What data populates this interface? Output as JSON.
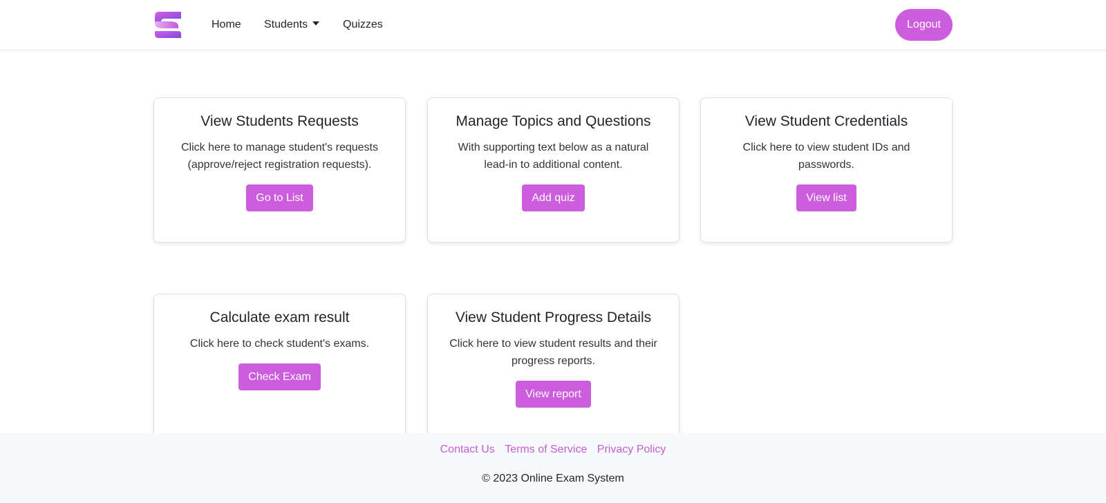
{
  "navbar": {
    "logo_icon": "brand-s-logo",
    "links": {
      "home": "Home",
      "students": "Students",
      "quizzes": "Quizzes"
    },
    "logout_label": "Logout"
  },
  "cards": [
    {
      "title": "View Students Requests",
      "text": "Click here to manage student's requests (approve/reject registration requests).",
      "button": "Go to List"
    },
    {
      "title": "Manage Topics and Questions",
      "text": "With supporting text below as a natural lead-in to additional content.",
      "button": "Add quiz"
    },
    {
      "title": "View Student Credentials",
      "text": "Click here to view student IDs and passwords.",
      "button": "View list"
    },
    {
      "title": "Calculate exam result",
      "text": "Click here to check student's exams.",
      "button": "Check Exam"
    },
    {
      "title": "View Student Progress Details",
      "text": "Click here to view student results and their progress reports.",
      "button": "View report"
    }
  ],
  "footer": {
    "links": [
      "Contact Us",
      "Terms of Service",
      "Privacy Policy"
    ],
    "copyright": "© 2023 Online Exam System"
  },
  "colors": {
    "accent": "#cc5ddd",
    "footer_link": "#c25ed4",
    "footer_bg": "#f8f9fa"
  }
}
